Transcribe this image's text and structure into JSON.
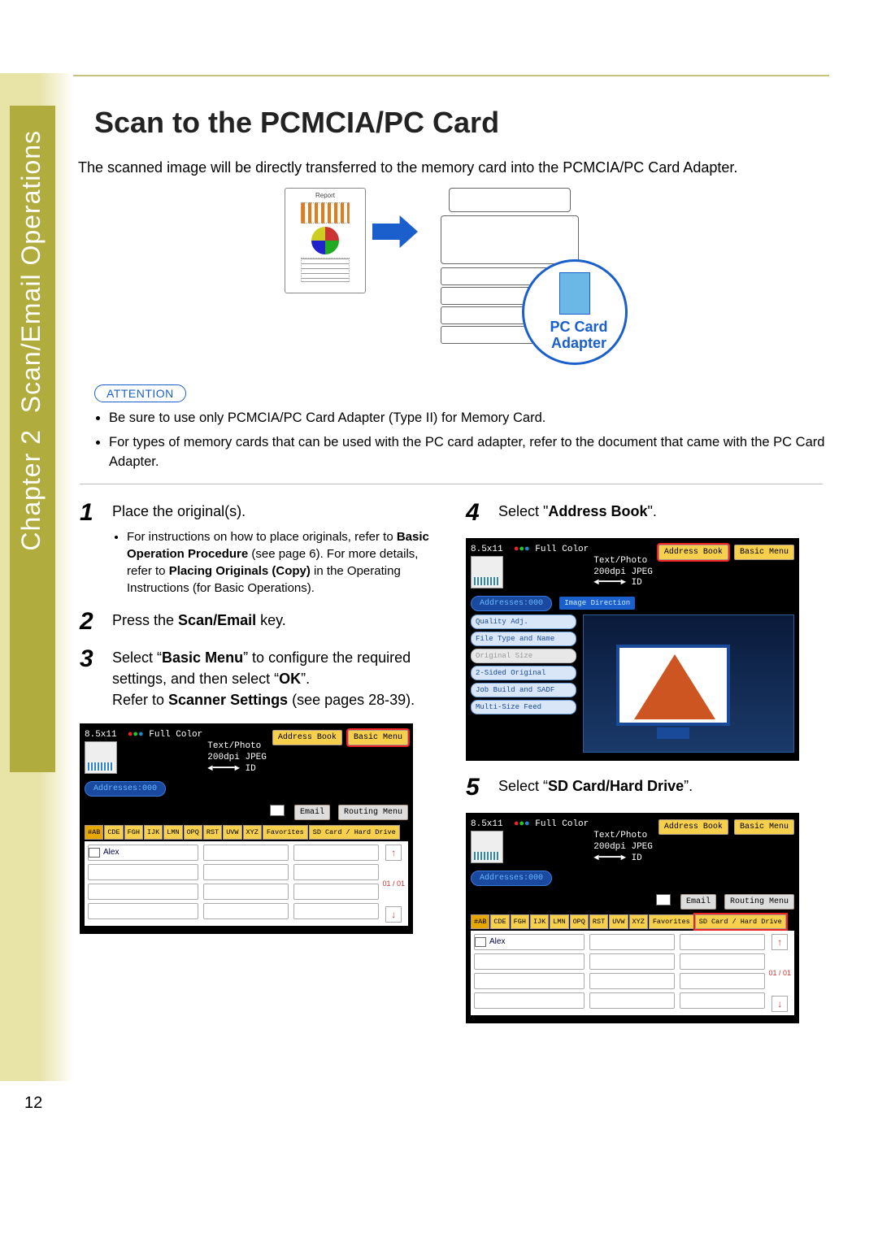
{
  "side": {
    "chapter_line1": "Chapter 2",
    "chapter_line2": "Scan/Email Operations"
  },
  "title": "Scan to the PCMCIA/PC Card",
  "intro": "The scanned image will be directly transferred to the memory card into the PCMCIA/PC Card Adapter.",
  "diagram": {
    "report_label": "Report",
    "adapter_label_l1": "PC Card",
    "adapter_label_l2": "Adapter"
  },
  "attention": {
    "label": "ATTENTION",
    "items": [
      "Be sure to use only PCMCIA/PC Card Adapter (Type II) for Memory Card.",
      "For types of memory cards that can be used with the PC card adapter, refer to the document that came with the PC Card Adapter."
    ]
  },
  "steps": {
    "s1": {
      "num": "1",
      "text": "Place the original(s).",
      "sub_a": "For instructions on how to place originals, refer to ",
      "sub_b": "Basic Operation Procedure",
      "sub_c": " (see page 6). For more details, refer to ",
      "sub_d": "Placing Originals (Copy)",
      "sub_e": " in the Operating Instructions (for Basic Operations)."
    },
    "s2": {
      "num": "2",
      "pre": "Press the ",
      "bold": "Scan/Email",
      "post": " key."
    },
    "s3": {
      "num": "3",
      "pre": "Select “",
      "bold1": "Basic Menu",
      "mid": "” to configure the required settings, and then select “",
      "bold2": "OK",
      "post": "”.",
      "line2a": "Refer to ",
      "line2b": "Scanner Settings",
      "line2c": " (see pages 28-39)."
    },
    "s4": {
      "num": "4",
      "pre": "Select \"",
      "bold": "Address Book",
      "post": "\"."
    },
    "s5": {
      "num": "5",
      "pre": "Select “",
      "bold": "SD Card/Hard Drive",
      "post": "”."
    }
  },
  "screen_common": {
    "size": "8.5x11",
    "full_color": "Full Color",
    "text_photo": "Text/Photo",
    "dpi": "200dpi JPEG",
    "id_lbl": "ID",
    "addresses": "Addresses:000",
    "address_book": "Address Book",
    "basic_menu": "Basic Menu",
    "email": "Email",
    "routing_menu": "Routing Menu",
    "tabs": [
      "#AB",
      "CDE",
      "FGH",
      "IJK",
      "LMN",
      "OPQ",
      "RST",
      "UVW",
      "XYZ",
      "Favorites",
      "SD Card / Hard Drive"
    ],
    "alex": "Alex",
    "scroll": "01\n/\n01"
  },
  "screen4": {
    "image_direction": "Image Direction",
    "buttons": [
      "Quality Adj.",
      "File Type and Name",
      "Original Size",
      "2-Sided Original",
      "Job Build and SADF",
      "Multi-Size Feed"
    ]
  },
  "page_number": "12"
}
